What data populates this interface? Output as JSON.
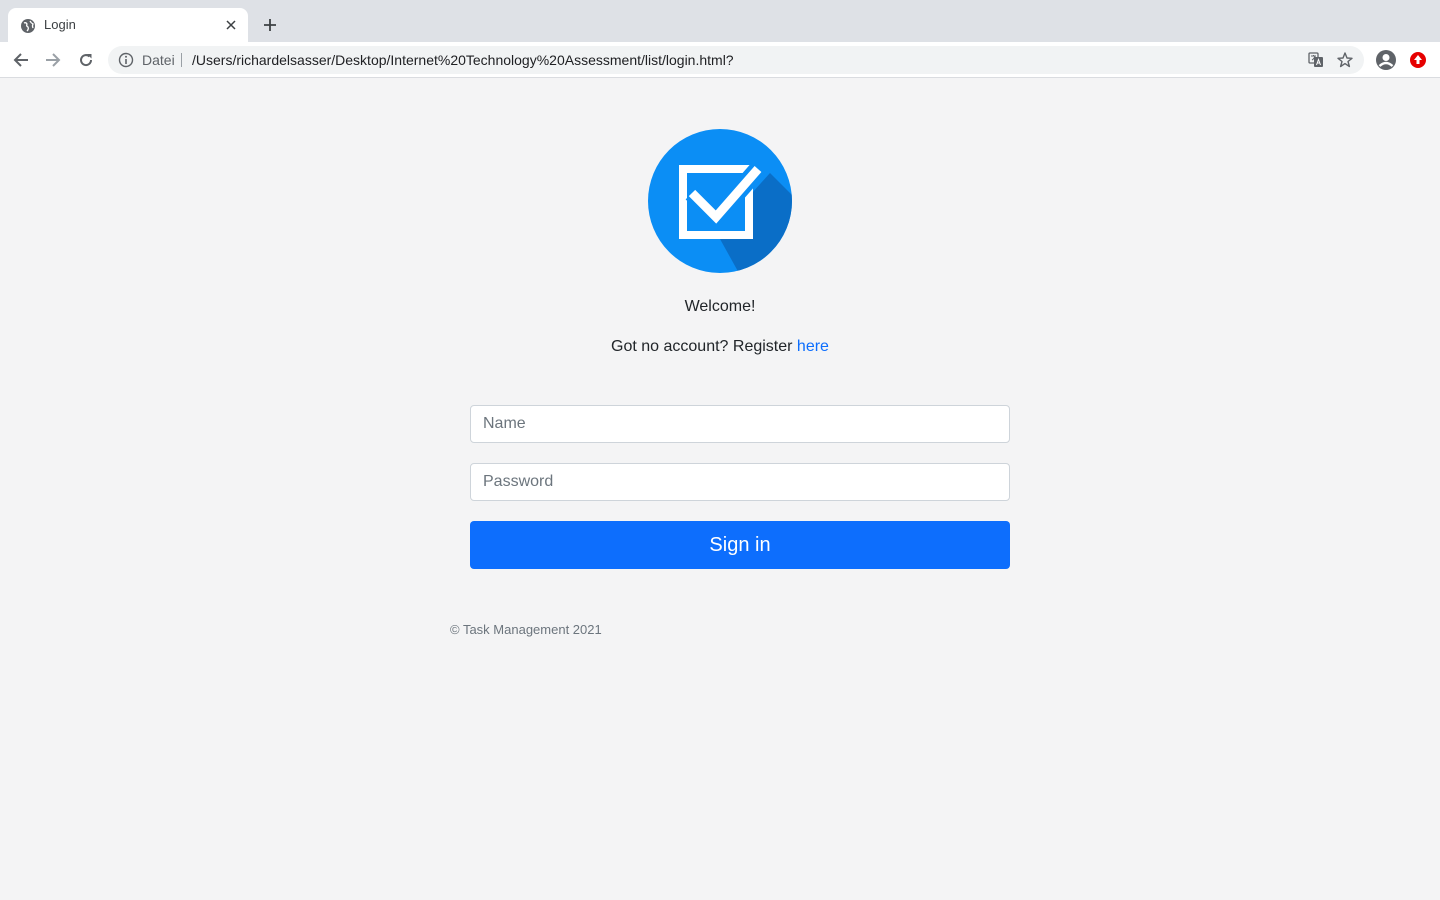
{
  "browser": {
    "tab": {
      "title": "Login",
      "favicon": "globe-icon",
      "close": "close-icon"
    },
    "new_tab": "plus-icon",
    "omnibox": {
      "scheme_label": "Datei",
      "url": "/Users/richardelsasser/Desktop/Internet%20Technology%20Assessment/list/login.html?"
    },
    "toolbar_icons": [
      "back-icon",
      "forward-icon",
      "reload-icon",
      "info-icon",
      "translate-icon",
      "star-icon",
      "profile-icon",
      "extension-icon"
    ]
  },
  "page": {
    "logo": "checkbox-logo",
    "welcome": "Welcome!",
    "register_prefix": "Got no account? Register ",
    "register_link": "here",
    "name_placeholder": "Name",
    "password_placeholder": "Password",
    "signin_label": "Sign in",
    "footer": "© Task Management 2021"
  },
  "colors": {
    "primary": "#0d6efd",
    "logo_circle": "#0b8ef5",
    "background": "#f4f4f5"
  }
}
